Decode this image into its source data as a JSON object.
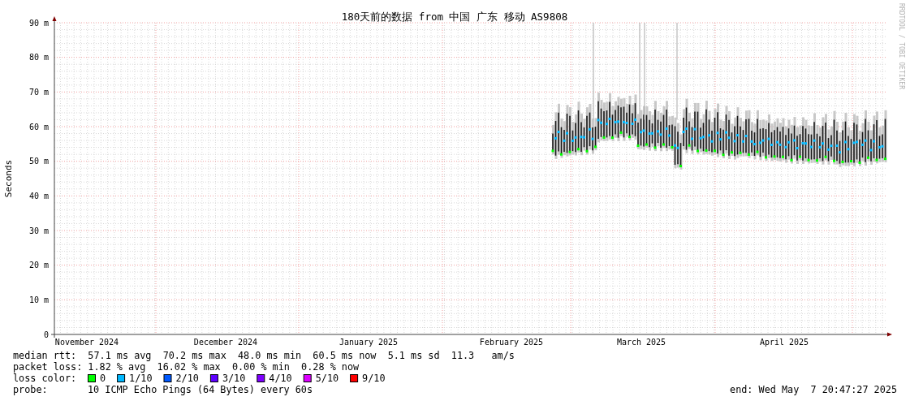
{
  "title": "180天前的数据 from 中国 广东 移动 AS9808",
  "credit": "RRDTOOL / TOBI OETIKER",
  "y_axis": {
    "label": "Seconds",
    "ticks": [
      "90 m",
      "80 m",
      "70 m",
      "60 m",
      "50 m",
      "40 m",
      "30 m",
      "20 m",
      "10 m",
      "0"
    ]
  },
  "x_axis": {
    "ticks": [
      "November 2024",
      "December 2024",
      "January 2025",
      "February 2025",
      "March 2025",
      "April 2025"
    ]
  },
  "legend": {
    "median_rtt": "median rtt:  57.1 ms avg  70.2 ms max  48.0 ms min  60.5 ms now  5.1 ms sd  11.3   am/s",
    "packet_loss": "packet loss: 1.82 % avg  16.02 % max  0.00 % min  0.28 % now",
    "loss_color": {
      "label": "loss color:",
      "items": [
        {
          "label": "0",
          "color": "#00ff00"
        },
        {
          "label": "1/10",
          "color": "#00b8ff"
        },
        {
          "label": "2/10",
          "color": "#0059ff"
        },
        {
          "label": "3/10",
          "color": "#5e00ff"
        },
        {
          "label": "4/10",
          "color": "#7e00ff"
        },
        {
          "label": "5/10",
          "color": "#dd00ff"
        },
        {
          "label": "9/10",
          "color": "#ff0000"
        }
      ]
    },
    "probe": {
      "label": "probe:",
      "value": "10 ICMP Echo Pings (64 Bytes) every 60s"
    },
    "end": "end: Wed May  7 20:47:27 2025"
  }
}
